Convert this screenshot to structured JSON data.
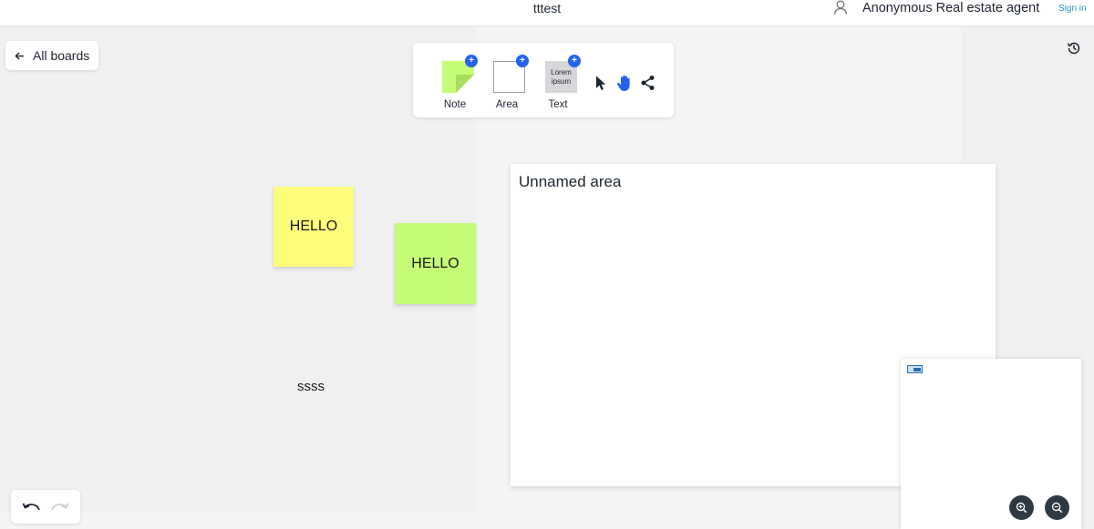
{
  "header": {
    "board_title": "tttest",
    "user_name": "Anonymous Real estate agent",
    "sign_in_label": "Sign in"
  },
  "nav": {
    "all_boards_label": "All boards"
  },
  "toolbar": {
    "note_label": "Note",
    "area_label": "Area",
    "text_label": "Text",
    "text_preview_line1": "Lorem",
    "text_preview_line2": "ipsum",
    "plus_symbol": "+"
  },
  "board": {
    "notes": [
      {
        "text": "HELLO",
        "color": "#fdfd7c"
      },
      {
        "text": "HELLO",
        "color": "#c5fb77"
      }
    ],
    "free_text": "ssss",
    "area_title": "Unnamed area"
  },
  "colors": {
    "accent": "#2563eb",
    "sign_in": "#2a8fd6",
    "zoom_button": "#2f3944"
  },
  "icons": {
    "user": "user-icon",
    "back": "arrow-left-icon",
    "history": "history-icon",
    "pointer": "cursor-pointer-icon",
    "hand": "hand-icon",
    "share": "share-icon",
    "zoom_in": "zoom-in-icon",
    "zoom_out": "zoom-out-icon",
    "undo": "undo-icon",
    "redo": "redo-icon"
  }
}
